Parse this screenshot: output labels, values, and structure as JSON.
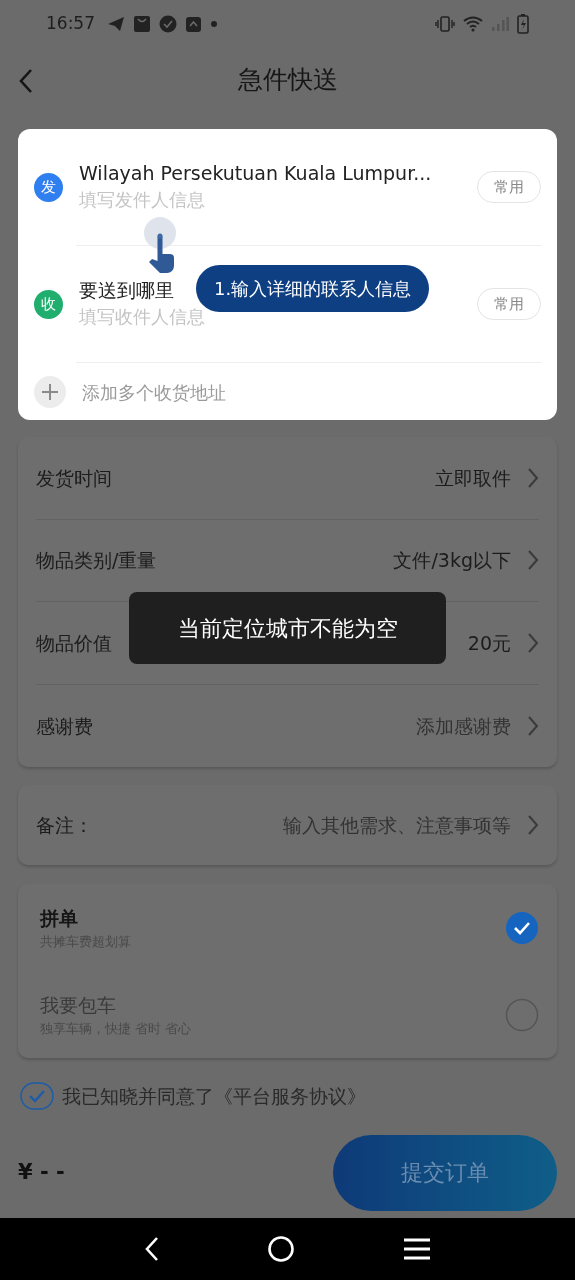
{
  "status_bar": {
    "time": "16:57"
  },
  "header": {
    "title": "急件快送"
  },
  "address_card": {
    "addresses": [
      {
        "badge": "发",
        "color": "#2f7ff0",
        "title": "Wilayah Persekutuan Kuala Lumpur...",
        "hint": "填写发件人信息",
        "button": "常用"
      },
      {
        "badge": "收",
        "color": "#1fae6e",
        "title": "要送到哪里",
        "hint": "填写收件人信息",
        "button": "常用"
      }
    ],
    "add_label": "添加多个收货地址"
  },
  "guide_tip": {
    "text": "1.输入详细的联系人信息"
  },
  "details": [
    {
      "label": "发货时间",
      "value": "立即取件"
    },
    {
      "label": "物品类别/重量",
      "value": "文件/3kg以下"
    },
    {
      "label": "物品价值",
      "value": "20元"
    },
    {
      "label": "感谢费",
      "placeholder": "添加感谢费"
    }
  ],
  "remark": {
    "label": "备注：",
    "placeholder": "输入其他需求、注意事项等"
  },
  "options": [
    {
      "title": "拼单",
      "subtitle": "共摊车费超划算",
      "selected": true
    },
    {
      "title": "我要包车",
      "subtitle": "独享车辆，快捷 省时 省心",
      "selected": false
    }
  ],
  "agreement": {
    "text": "我已知晓并同意了",
    "link": "《平台服务协议》",
    "checked": true
  },
  "footer": {
    "price": "¥ - -",
    "submit": "提交订单"
  },
  "toast": {
    "text": "当前定位城市不能为空"
  }
}
